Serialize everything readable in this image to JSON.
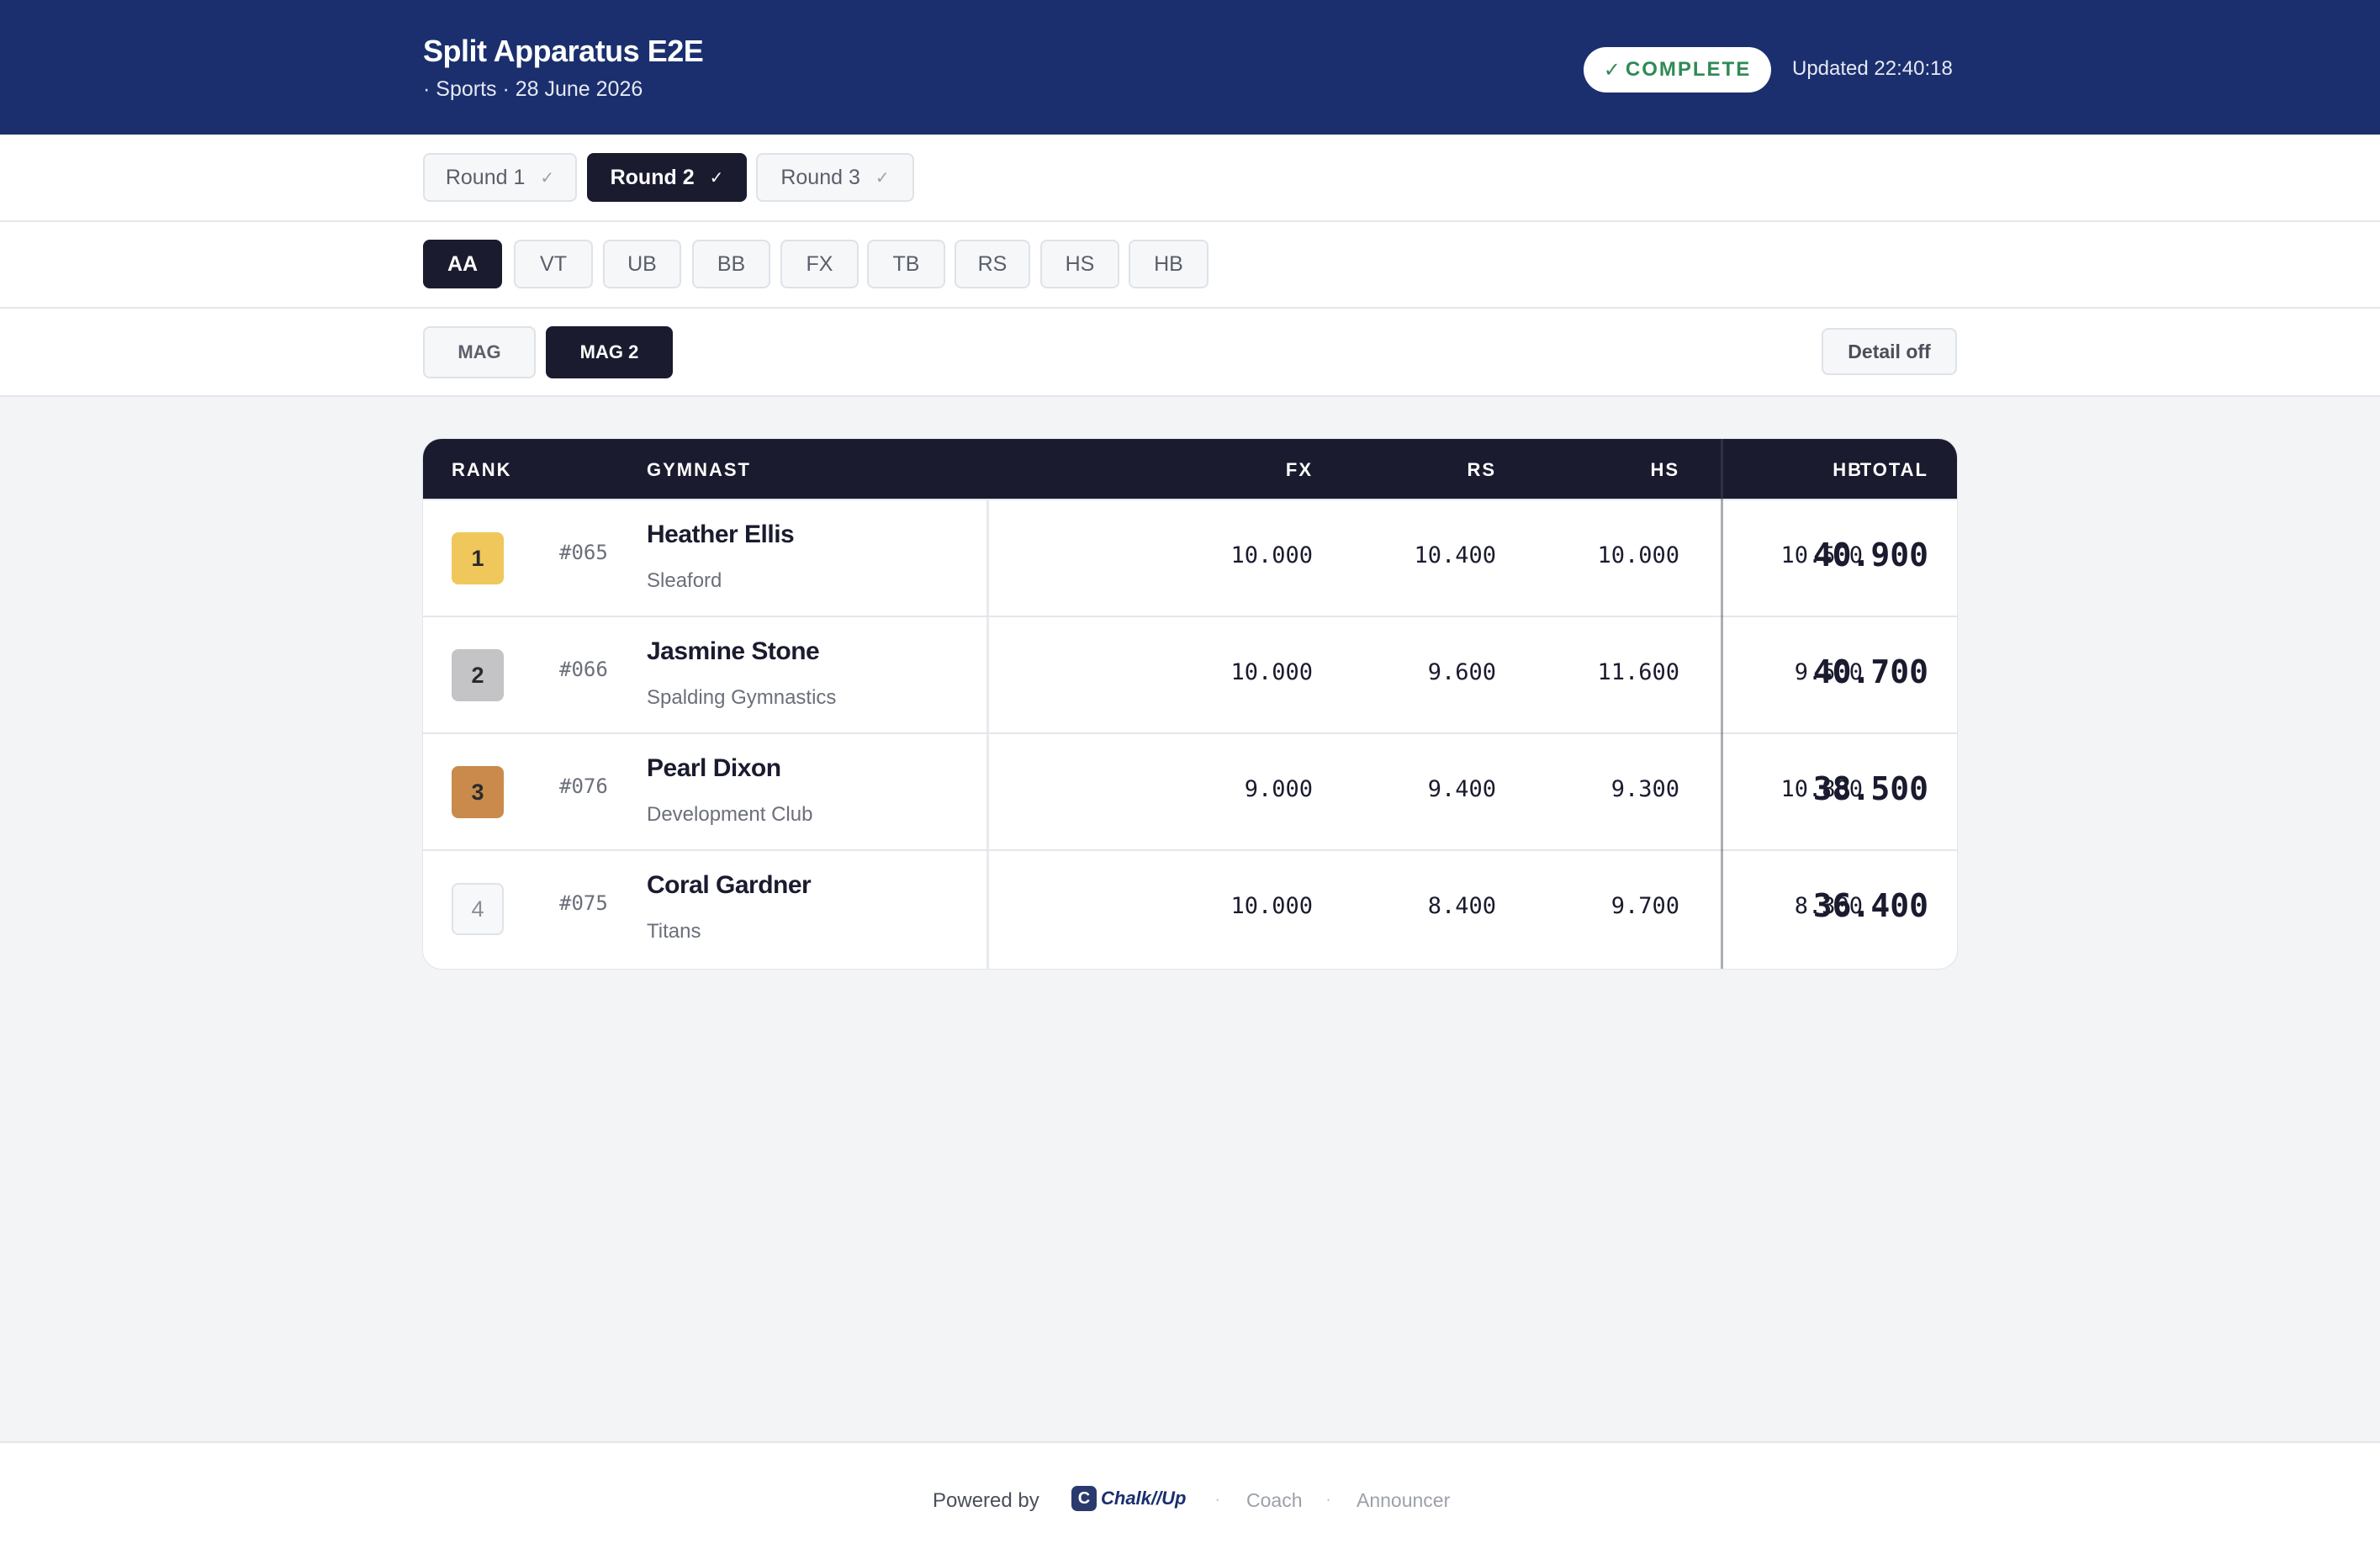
{
  "header": {
    "title": "Split Apparatus E2E",
    "subtitle": "· Sports · 28 June 2026",
    "status": "COMPLETE",
    "status_check": "✓",
    "updated": "Updated 22:40:18",
    "colors": {
      "bar": "#1b2f6e",
      "status_text": "#2f8a55"
    }
  },
  "rounds": [
    {
      "label": "Round 1",
      "check": "✓",
      "active": false
    },
    {
      "label": "Round 2",
      "check": "✓",
      "active": true
    },
    {
      "label": "Round 3",
      "check": "✓",
      "active": false
    }
  ],
  "apparatus": [
    {
      "label": "AA",
      "active": true
    },
    {
      "label": "VT",
      "active": false
    },
    {
      "label": "UB",
      "active": false
    },
    {
      "label": "BB",
      "active": false
    },
    {
      "label": "FX",
      "active": false
    },
    {
      "label": "TB",
      "active": false
    },
    {
      "label": "RS",
      "active": false
    },
    {
      "label": "HS",
      "active": false
    },
    {
      "label": "HB",
      "active": false
    }
  ],
  "categories": [
    {
      "label": "MAG",
      "active": false
    },
    {
      "label": "MAG 2",
      "active": true
    }
  ],
  "detail_toggle": "Detail off",
  "table": {
    "headers": {
      "rank": "RANK",
      "gymnast": "GYMNAST",
      "fx": "FX",
      "rs": "RS",
      "hs": "HS",
      "hb": "HB",
      "total": "TOTAL"
    },
    "rows": [
      {
        "rank": "1",
        "bib": "#065",
        "name": "Heather Ellis",
        "club": "Sleaford",
        "fx": "10.000",
        "rs": "10.400",
        "hs": "10.000",
        "hb": "10.500",
        "total": "40.900"
      },
      {
        "rank": "2",
        "bib": "#066",
        "name": "Jasmine Stone",
        "club": "Spalding Gymnastics",
        "fx": "10.000",
        "rs": "9.600",
        "hs": "11.600",
        "hb": "9.500",
        "total": "40.700"
      },
      {
        "rank": "3",
        "bib": "#076",
        "name": "Pearl Dixon",
        "club": "Development Club",
        "fx": "9.000",
        "rs": "9.400",
        "hs": "9.300",
        "hb": "10.800",
        "total": "38.500"
      },
      {
        "rank": "4",
        "bib": "#075",
        "name": "Coral Gardner",
        "club": "Titans",
        "fx": "10.000",
        "rs": "8.400",
        "hs": "9.700",
        "hb": "8.300",
        "total": "36.400"
      }
    ],
    "rank_colors": [
      "#f0c75a",
      "#c4c4c6",
      "#c98a4b",
      "#ffffff"
    ]
  },
  "footer": {
    "powered_by": "Powered by",
    "logo_text": "Chalk//Up",
    "logo_mark": "C",
    "separator": "·",
    "link_coach": "Coach",
    "link_announcer": "Announcer"
  }
}
